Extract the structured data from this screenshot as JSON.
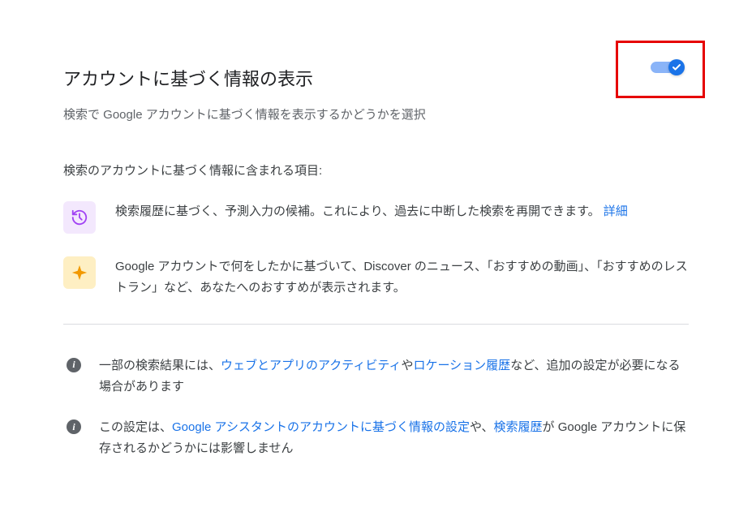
{
  "header": {
    "title": "アカウントに基づく情報の表示",
    "subtitle": "検索で Google アカウントに基づく情報を表示するかどうかを選択"
  },
  "toggle": {
    "state": "on"
  },
  "includesLabel": "検索のアカウントに基づく情報に含まれる項目:",
  "items": [
    {
      "icon": "history",
      "text": "検索履歴に基づく、予測入力の候補。これにより、過去に中断した検索を再開できます。",
      "linkText": "詳細"
    },
    {
      "icon": "sparkle",
      "text": "Google アカウントで何をしたかに基づいて、Discover のニュース、「おすすめの動画」、「おすすめのレストラン」など、あなたへのおすすめが表示されます。"
    }
  ],
  "notes": [
    {
      "pre": "一部の検索結果には、",
      "link1": "ウェブとアプリのアクティビティ",
      "mid": "や",
      "link2": "ロケーション履歴",
      "post": "など、追加の設定が必要になる場合があります"
    },
    {
      "pre": "この設定は、",
      "link1": "Google アシスタントのアカウントに基づく情報の設定",
      "mid": "や、",
      "link2": "検索履歴",
      "post": "が Google アカウントに保存されるかどうかには影響しません"
    }
  ]
}
